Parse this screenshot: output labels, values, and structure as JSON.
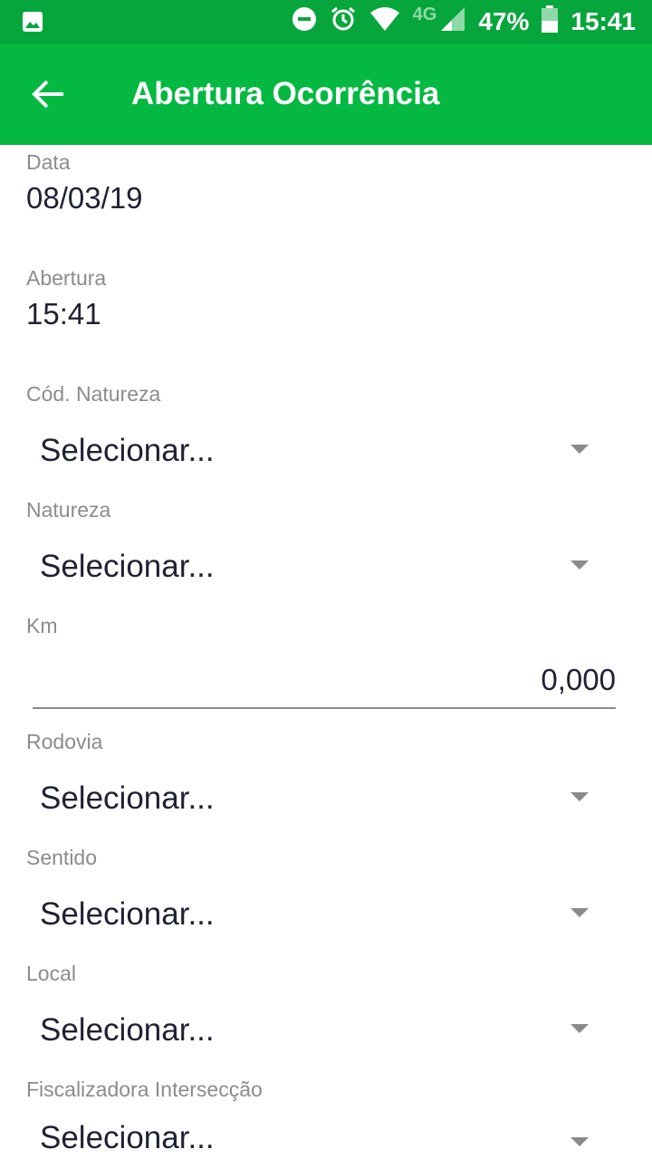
{
  "status_bar": {
    "network": "4G",
    "battery": "47%",
    "time": "15:41",
    "icons": [
      "image-icon",
      "do-not-disturb-icon",
      "alarm-icon",
      "wifi-icon",
      "cell-signal-icon",
      "battery-icon"
    ]
  },
  "app_bar": {
    "title": "Abertura Ocorrência",
    "back_icon": "arrow-back-icon",
    "background": "#04b842"
  },
  "form": {
    "data": {
      "label": "Data",
      "value": "08/03/19"
    },
    "abertura": {
      "label": "Abertura",
      "value": "15:41"
    },
    "cod_natureza": {
      "label": "Cód. Natureza",
      "value": "Selecionar..."
    },
    "natureza": {
      "label": "Natureza",
      "value": "Selecionar..."
    },
    "km": {
      "label": "Km",
      "value": "0,000"
    },
    "rodovia": {
      "label": "Rodovia",
      "value": "Selecionar..."
    },
    "sentido": {
      "label": "Sentido",
      "value": "Selecionar..."
    },
    "local": {
      "label": "Local",
      "value": "Selecionar..."
    },
    "fiscalizadora": {
      "label": "Fiscalizadora Intersecção",
      "value": "Selecionar..."
    }
  }
}
